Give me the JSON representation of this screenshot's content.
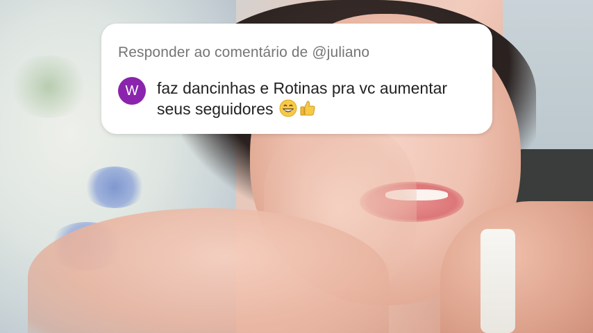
{
  "reply_sticker": {
    "header": "Responder ao comentário de @juliano",
    "avatar_letter": "W",
    "comment": "faz dancinhas e Rotinas pra vc aumentar seus seguidores",
    "emojis": [
      "grinning-face-with-smiling-eyes",
      "thumbs-up"
    ],
    "avatar_color": "#8a24ad"
  }
}
